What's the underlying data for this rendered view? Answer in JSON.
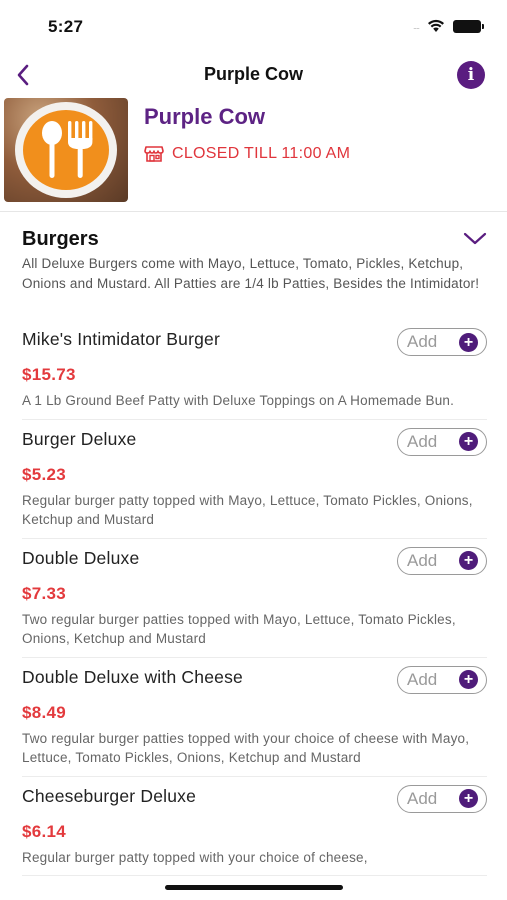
{
  "status_bar": {
    "time": "5:27",
    "signal_dots": "....",
    "wifi_icon": "wifi-icon",
    "battery_icon": "battery-icon"
  },
  "nav": {
    "title": "Purple Cow",
    "back_icon": "chevron-left-icon",
    "info_icon": "info-icon",
    "info_glyph": "i"
  },
  "restaurant": {
    "name": "Purple Cow",
    "status": "CLOSED TILL 11:00 AM",
    "status_icon": "storefront-icon",
    "logo_icon": "spoon-fork-logo"
  },
  "category": {
    "title": "Burgers",
    "description": "All Deluxe Burgers come with Mayo, Lettuce, Tomato, Pickles, Ketchup, Onions and Mustard. All Patties are 1/4 lb Patties, Besides the Intimidator!",
    "toggle_icon": "chevron-down-icon"
  },
  "items": [
    {
      "name": "Mike's Intimidator Burger",
      "price": "$15.73",
      "description": "A 1 Lb Ground Beef Patty with Deluxe Toppings on A Homemade Bun.",
      "add_label": "Add",
      "add_glyph": "+"
    },
    {
      "name": "Burger Deluxe",
      "price": "$5.23",
      "description": "Regular burger patty topped with Mayo, Lettuce, Tomato Pickles, Onions, Ketchup and Mustard",
      "add_label": "Add",
      "add_glyph": "+"
    },
    {
      "name": "Double Deluxe",
      "price": "$7.33",
      "description": "Two regular burger patties topped with Mayo, Lettuce, Tomato Pickles, Onions, Ketchup and Mustard",
      "add_label": "Add",
      "add_glyph": "+"
    },
    {
      "name": "Double Deluxe with Cheese",
      "price": "$8.49",
      "description": "Two regular burger patties topped with your choice of cheese with Mayo, Lettuce, Tomato Pickles, Onions, Ketchup and Mustard",
      "add_label": "Add",
      "add_glyph": "+"
    },
    {
      "name": "Cheeseburger Deluxe",
      "price": "$6.14",
      "description": "Regular burger patty topped with your choice of cheese,",
      "add_label": "Add",
      "add_glyph": "+"
    }
  ],
  "colors": {
    "brand_purple": "#5d2384",
    "accent_red": "#e33a3d",
    "logo_orange": "#f18f1c"
  }
}
